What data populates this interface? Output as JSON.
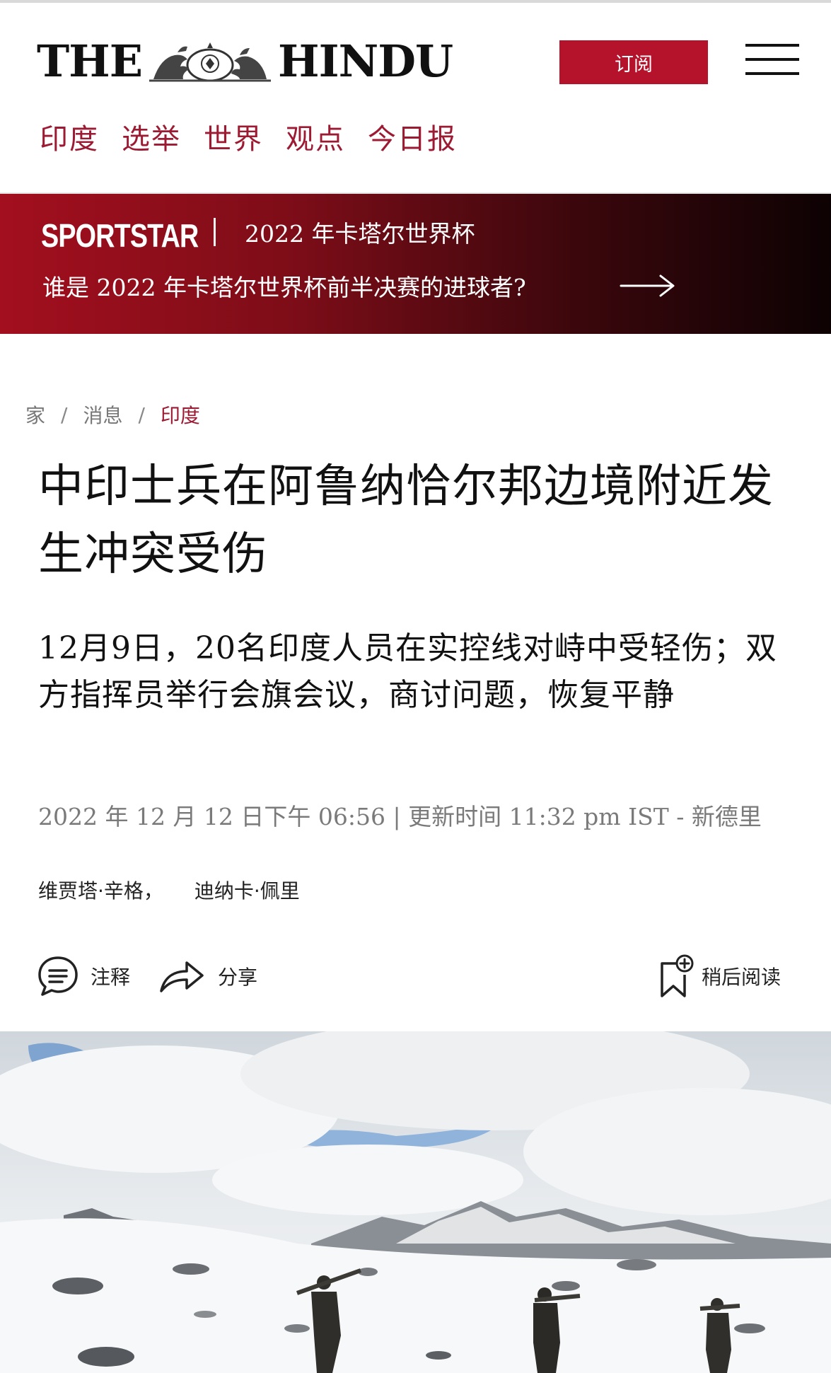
{
  "header": {
    "logo_left": "THE",
    "logo_right": "HINDU",
    "subscribe_label": "订阅",
    "nav": [
      "印度",
      "选举",
      "世界",
      "观点",
      "今日报"
    ]
  },
  "banner": {
    "brand": "SPORTSTAR",
    "topic": "2022 年卡塔尔世界杯",
    "question": "谁是 2022 年卡塔尔世界杯前半决赛的进球者?"
  },
  "breadcrumb": [
    "家",
    "消息",
    "印度"
  ],
  "article": {
    "title": "中印士兵在阿鲁纳恰尔邦边境附近发生冲突受伤",
    "subtitle": "12月9日，20名印度人员在实控线对峙中受轻伤；双方指挥员举行会旗会议，商讨问题，恢复平静",
    "dateline": "2022 年 12 月 12 日下午 06:56 | 更新时间 11:32 pm IST - 新德里",
    "authors": [
      "维贾塔·辛格，",
      "迪纳卡·佩里"
    ]
  },
  "actions": {
    "comment": "注释",
    "share": "分享",
    "read_later": "稍后阅读"
  },
  "colors": {
    "brand_red": "#b5122b",
    "nav_red": "#9d1a33"
  }
}
